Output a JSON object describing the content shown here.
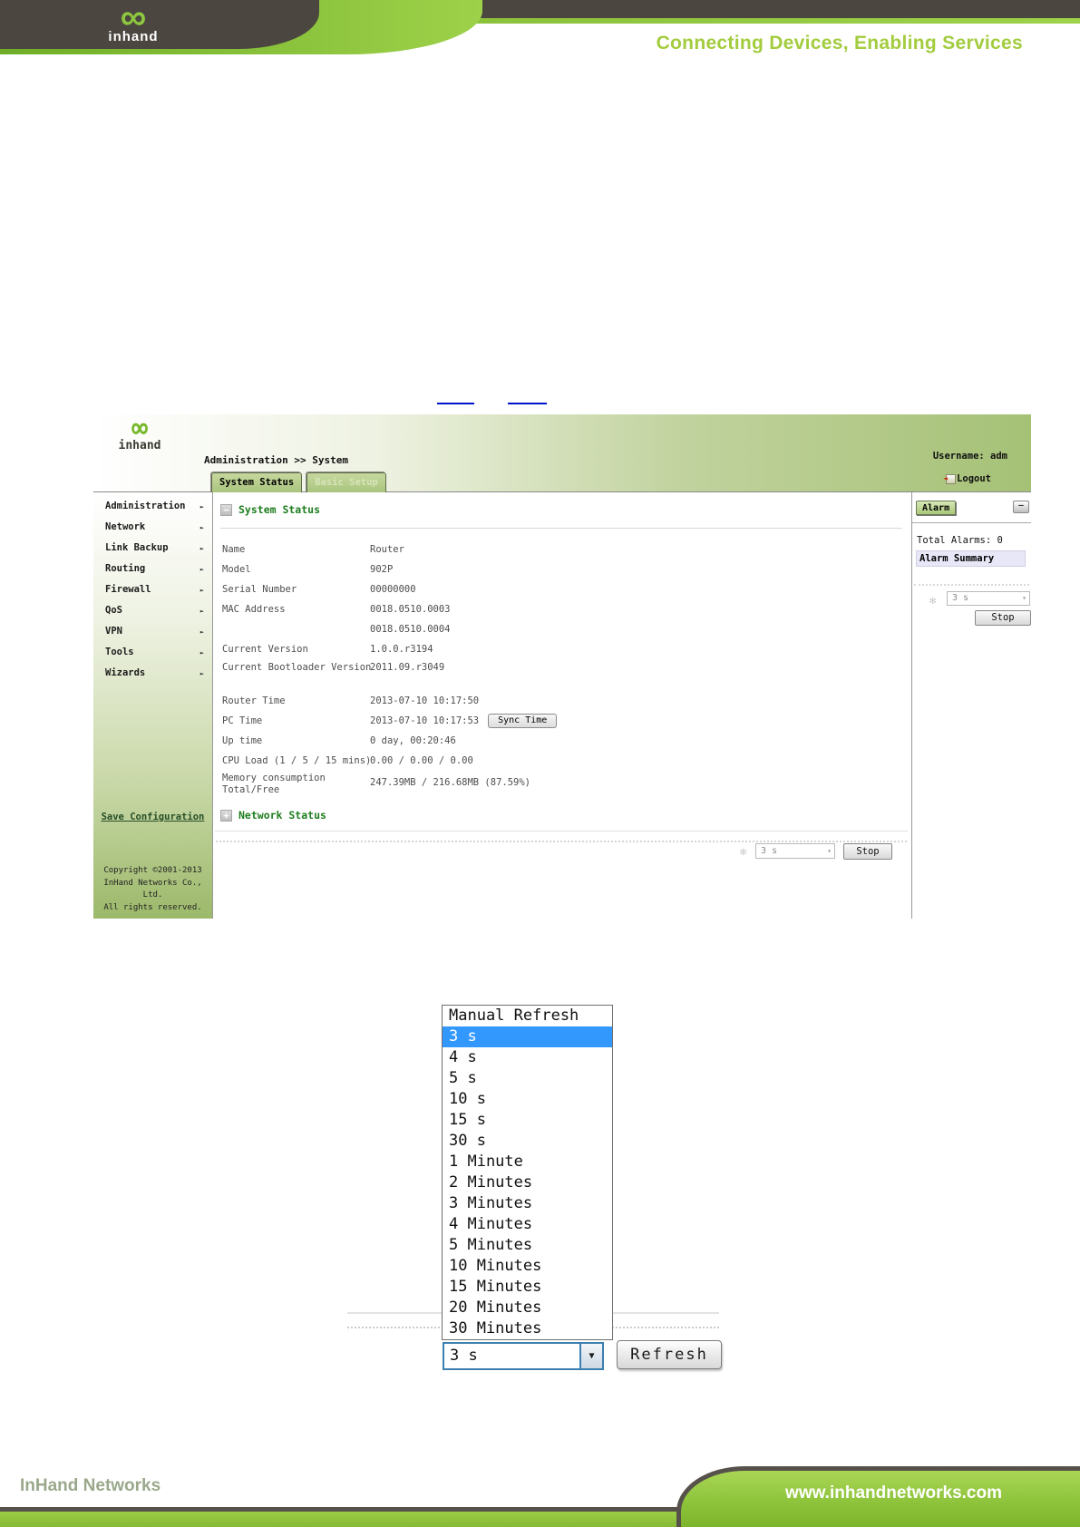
{
  "icons": {
    "infinity": "∞",
    "menu_arrow": "►",
    "collapse": "−",
    "expand": "+",
    "minimize": "—",
    "spinner": "✻",
    "arrow_small": "▾",
    "arrow_down": "▼",
    "logout_arrow": "◄"
  },
  "colors": {
    "accent_green": "#8dc63f",
    "header_dark": "#4b4640",
    "selected_blue": "#3398fe",
    "alarm_summary_bg": "#e7e7f8"
  },
  "page_header": {
    "logo_text": "inhand",
    "tagline": "Connecting Devices, Enabling Services"
  },
  "screenshot1": {
    "header": {
      "breadcrumb": "Administration >> System",
      "username": "Username: adm",
      "logout_label": "Logout",
      "tabs": [
        {
          "label": "System Status"
        },
        {
          "label": "Basic Setup"
        }
      ]
    },
    "sidebar": {
      "items": [
        "Administration",
        "Network",
        "Link Backup",
        "Routing",
        "Firewall",
        "QoS",
        "VPN",
        "Tools",
        "Wizards"
      ],
      "save_config": "Save Configuration",
      "copyright": [
        "Copyright ©2001-2013",
        "InHand Networks Co., Ltd.",
        "All rights reserved."
      ]
    },
    "system_status": {
      "title": "System Status",
      "rows": [
        {
          "label": "Name",
          "value": "Router"
        },
        {
          "label": "Model",
          "value": "902P"
        },
        {
          "label": "Serial Number",
          "value": "00000000"
        },
        {
          "label": "MAC Address",
          "value": "0018.0510.0003"
        },
        {
          "label": "",
          "value": "0018.0510.0004"
        },
        {
          "label": "Current Version",
          "value": "1.0.0.r3194"
        },
        {
          "label": "Current Bootloader Version",
          "value": "2011.09.r3049"
        },
        {
          "label": "Router Time",
          "value": "2013-07-10 10:17:50"
        },
        {
          "label": "PC Time",
          "value": "2013-07-10 10:17:53",
          "button": "Sync Time"
        },
        {
          "label": "Up time",
          "value": "0 day, 00:20:46"
        },
        {
          "label": "CPU Load (1 / 5 / 15 mins)",
          "value": "0.00 / 0.00 / 0.00"
        },
        {
          "label": "Memory consumption Total/Free",
          "value": "247.39MB / 216.68MB (87.59%)"
        }
      ]
    },
    "network_status_title": "Network Status",
    "refresh_bar": {
      "interval": "3 s",
      "stop": "Stop"
    },
    "alarm": {
      "tab": "Alarm",
      "total": "Total Alarms: 0",
      "summary": "Alarm Summary",
      "interval": "3 s",
      "stop": "Stop"
    }
  },
  "screenshot2": {
    "options": [
      "Manual Refresh",
      "3 s",
      "4 s",
      "5 s",
      "10 s",
      "15 s",
      "30 s",
      "1 Minute",
      "2 Minutes",
      "3 Minutes",
      "4 Minutes",
      "5 Minutes",
      "10 Minutes",
      "15 Minutes",
      "20 Minutes",
      "30 Minutes"
    ],
    "selected_option": "3 s",
    "select_value": "3 s",
    "refresh": "Refresh"
  },
  "page_footer": {
    "company": "InHand Networks",
    "website": "www.inhandnetworks.com"
  }
}
